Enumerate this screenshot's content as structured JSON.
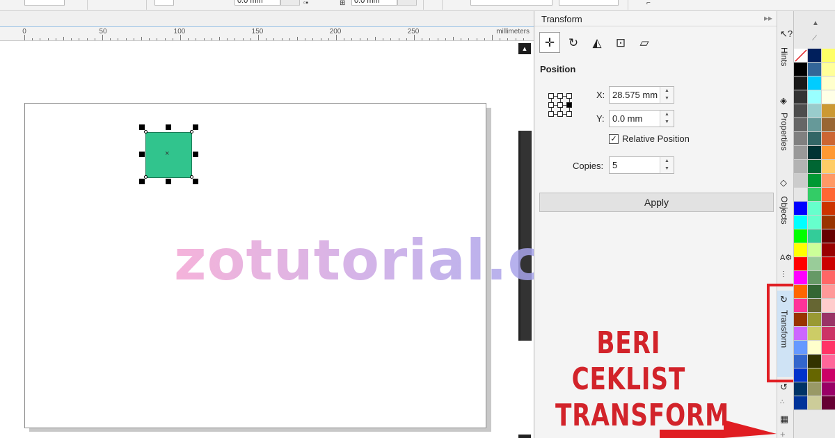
{
  "toolbar": {
    "field1": "0.0 mm",
    "field2": "0.0 mm",
    "field3": "0.0 mm"
  },
  "ruler": {
    "ticks": [
      "0",
      "50",
      "100",
      "150",
      "200",
      "250"
    ],
    "unit": "millimeters"
  },
  "canvas": {
    "watermark": "zotutorial.com"
  },
  "docker": {
    "title": "Transform",
    "section": "Position",
    "x_label": "X:",
    "x_value": "28.575 mm",
    "y_label": "Y:",
    "y_value": "0.0 mm",
    "relative_position_label": "Relative Position",
    "relative_position_checked": true,
    "copies_label": "Copies:",
    "copies_value": "5",
    "apply_label": "Apply",
    "annotation_line1": "BERI CEKLIST",
    "annotation_line2": "TRANSFORM"
  },
  "tabs": {
    "hints": "Hints",
    "properties": "Properties",
    "objects": "Objects",
    "transform": "Transform"
  },
  "palette": {
    "colors_col1": [
      "#ffffff",
      "#000000",
      "#1a1a1a",
      "#333333",
      "#4d4d4d",
      "#666666",
      "#808080",
      "#999999",
      "#b3b3b3",
      "#cccccc",
      "#e6e6e6",
      "#0000ff",
      "#00ffff",
      "#00ff00",
      "#ffff00",
      "#ff0000",
      "#ff00ff",
      "#ff6600",
      "#ff3399",
      "#993300",
      "#cc66ff",
      "#6699ff",
      "#3366cc",
      "#0033cc",
      "#003366",
      "#003399"
    ],
    "colors_col2": [
      "#001f5c",
      "#336699",
      "#00ccff",
      "#99ffff",
      "#99cccc",
      "#669999",
      "#336666",
      "#003333",
      "#006633",
      "#009933",
      "#33cc66",
      "#66ffcc",
      "#66ffcc",
      "#33cc99",
      "#ccff99",
      "#99cc99",
      "#669966",
      "#336633",
      "#666633",
      "#999933",
      "#cccc66",
      "#ffffcc",
      "#333300",
      "#666600",
      "#999966",
      "#cccc99"
    ],
    "colors_col3": [
      "#ffff66",
      "#ffff99",
      "#ffffcc",
      "#ffffe6",
      "#cc9933",
      "#996633",
      "#cc6633",
      "#ff9933",
      "#ffcc66",
      "#ff9966",
      "#ff6633",
      "#cc3300",
      "#993300",
      "#660000",
      "#990000",
      "#cc0000",
      "#ff6666",
      "#ff9999",
      "#ffcccc",
      "#993366",
      "#cc3366",
      "#ff3366",
      "#ff6699",
      "#cc0066",
      "#990066",
      "#660033"
    ]
  }
}
